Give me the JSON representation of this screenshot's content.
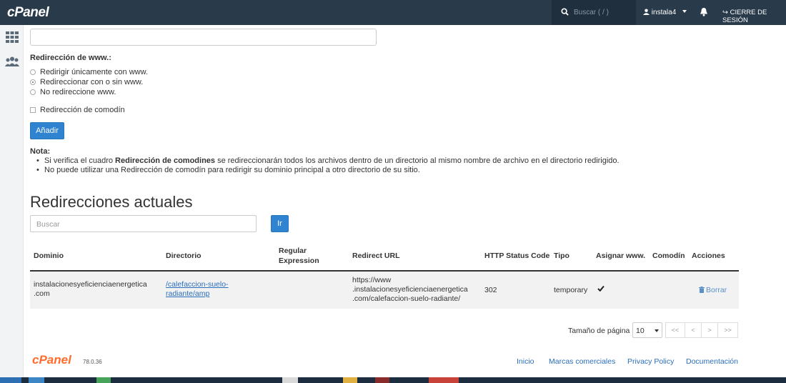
{
  "header": {
    "logo": "cPanel",
    "search_placeholder": "Buscar ( / )",
    "username": "instala4",
    "logout_label": "CIERRE DE SESIÓN"
  },
  "sidebar": {
    "items": [
      {
        "icon": "grid-icon"
      },
      {
        "icon": "users-icon"
      }
    ]
  },
  "form": {
    "www_redirect_label": "Redirección de www.:",
    "radio_options": [
      {
        "label": "Redirigir únicamente con www.",
        "selected": false
      },
      {
        "label": "Redireccionar con o sin www.",
        "selected": true
      },
      {
        "label": "No redireccione www.",
        "selected": false
      }
    ],
    "wildcard_label": "Redirección de comodín",
    "add_button": "Añadir"
  },
  "note": {
    "title": "Nota:",
    "bullet1_pre": "Si verifica el cuadro ",
    "bullet1_bold": "Redirección de comodines",
    "bullet1_post": " se redireccionarán todos los archivos dentro de un directorio al mismo nombre de archivo en el directorio redirigido.",
    "bullet2": "No puede utilizar una Redirección de comodín para redirigir su dominio principal a otro directorio de su sitio."
  },
  "current": {
    "heading": "Redirecciones actuales",
    "search_placeholder": "Buscar",
    "go_button": "Ir",
    "columns": {
      "domain": "Dominio",
      "directory": "Directorio",
      "regex_line1": "Regular",
      "regex_line2": "Expression",
      "redirect_url": "Redirect URL",
      "status": "HTTP Status Code",
      "type": "Tipo",
      "www": "Asignar www.",
      "wildcard": "Comodín",
      "actions": "Acciones"
    },
    "rows": [
      {
        "domain_l1": "instalacionesyeficienciaenergetica",
        "domain_l2": ".com",
        "dir_l1": "/calefaccion-suelo-",
        "dir_l2": "radiante/amp",
        "url_l1": "https://www",
        "url_l2": ".instalacionesyeficienciaenergetica",
        "url_l3": ".com/calefaccion-suelo-radiante/",
        "status": "302",
        "type": "temporary",
        "www_checked": true,
        "delete_label": "Borrar"
      }
    ]
  },
  "pagination": {
    "page_size_label": "Tamaño de página",
    "page_size": "10",
    "first": "<<",
    "prev": "<",
    "next": ">",
    "last": ">>"
  },
  "footer": {
    "logo": "cPanel",
    "version": "78.0.36",
    "links": [
      "Inicio",
      "Marcas comerciales",
      "Privacy Policy",
      "Documentación"
    ]
  },
  "colors": {
    "topbar": "#293a4a",
    "primary": "#2f83d0",
    "brand_orange": "#ff6c2c"
  }
}
